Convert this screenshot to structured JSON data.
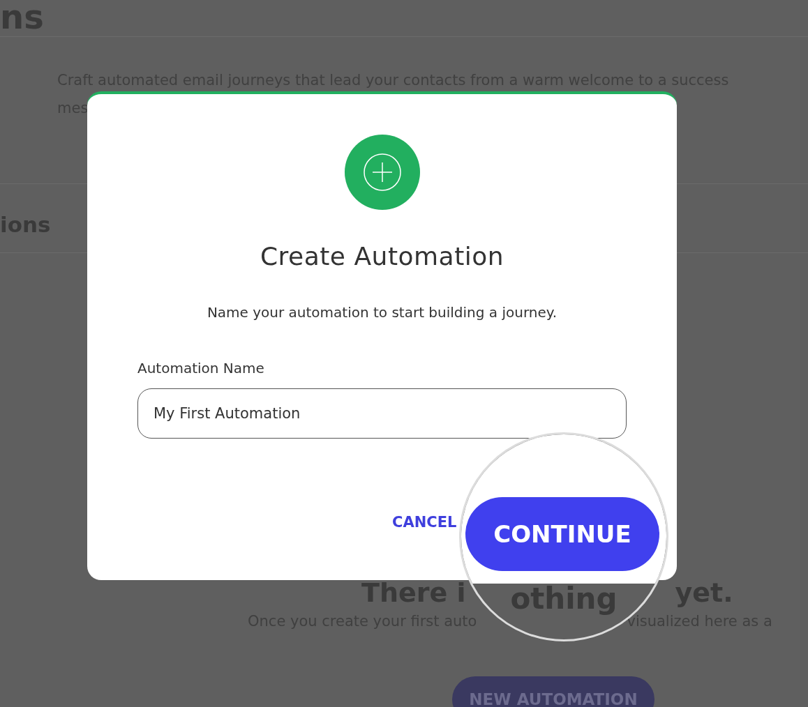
{
  "background": {
    "heading": "ns",
    "description": [
      "Craft automated email journeys that lead your contacts from a warm welcome to a success",
      "mes"
    ],
    "section_heading": "ions",
    "empty_title": [
      "There i",
      "yet."
    ],
    "empty_text": [
      "Once you create your first auto",
      "visualized here as a"
    ],
    "new_button": "NEW AUTOMATION"
  },
  "dialog": {
    "title": "Create Automation",
    "subtitle": "Name your automation to start building a journey.",
    "field": {
      "label": "Automation Name",
      "value": "My First Automation"
    },
    "cancel": "CANCEL"
  },
  "magnifier": {
    "button": "CONTINUE",
    "text": "othing"
  }
}
